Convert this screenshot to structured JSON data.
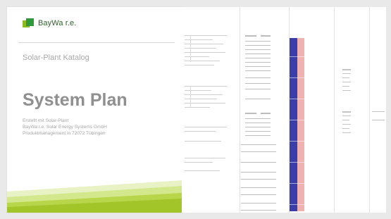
{
  "cover": {
    "brand": "BayWa r.e.",
    "subtitle": "Solar-Plant Katalog",
    "title": "System Plan",
    "info_lines": [
      "Erstellt mit Solar-Plant",
      "BayWa r.e. Solar Energy Systems GmbH",
      "Produktmanagement in 72072 Tübingen"
    ]
  },
  "colors": {
    "accent_green": "#8dbb1f",
    "dark_green": "#2e9a3c",
    "panel_blue": "#3b3ea8",
    "panel_pink": "#f0b2b0"
  }
}
